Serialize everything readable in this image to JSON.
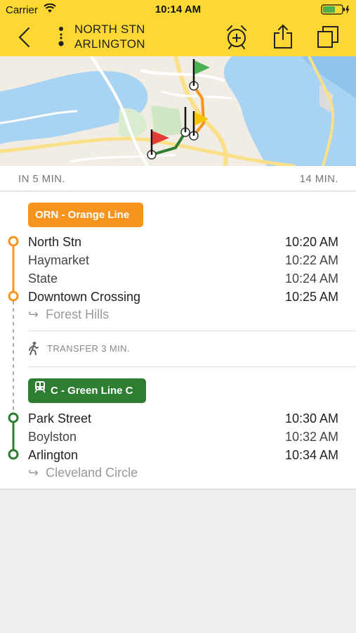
{
  "status_bar": {
    "carrier": "Carrier",
    "time": "10:14 AM"
  },
  "nav": {
    "from": "NORTH STN",
    "to": "ARLINGTON",
    "icons": [
      "back-chevron-icon",
      "route-dots-icon",
      "alarm-add-icon",
      "share-icon",
      "copy-icon"
    ]
  },
  "trip": {
    "departs_in": "IN 5 MIN.",
    "duration": "14 MIN."
  },
  "legs": [
    {
      "route_label": "ORN - Orange Line",
      "color": "#f7941d",
      "stops": [
        {
          "name": "North Stn",
          "time": "10:20 AM"
        },
        {
          "name": "Haymarket",
          "time": "10:22 AM"
        },
        {
          "name": "State",
          "time": "10:24 AM"
        },
        {
          "name": "Downtown Crossing",
          "time": "10:25 AM"
        }
      ],
      "toward": "Forest Hills"
    },
    {
      "route_label": "C - Green Line C",
      "color": "#2e7d32",
      "stops": [
        {
          "name": "Park Street",
          "time": "10:30 AM"
        },
        {
          "name": "Boylston",
          "time": "10:32 AM"
        },
        {
          "name": "Arlington",
          "time": "10:34 AM"
        }
      ],
      "toward": "Cleveland Circle"
    }
  ],
  "transfer": "TRANSFER 3 MIN.",
  "colors": {
    "header": "#fdd835",
    "orange": "#f7941d",
    "green": "#2e7d32",
    "water": "#a9d3f2"
  }
}
